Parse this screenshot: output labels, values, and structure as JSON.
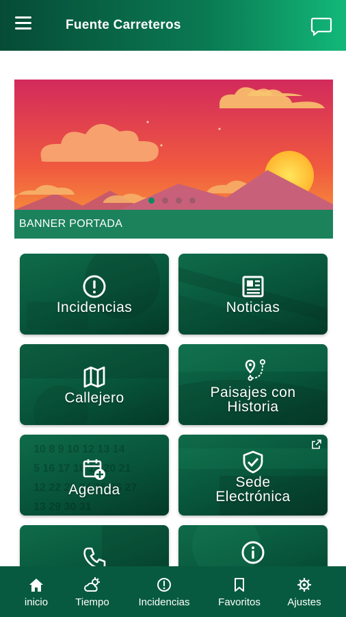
{
  "header": {
    "title": "Fuente Carreteros",
    "menu_icon": "hamburger-menu-icon",
    "chat_icon": "chat-bubble-icon"
  },
  "banner": {
    "caption": "BANNER PORTADA",
    "slides_count": 4,
    "active_slide": 1
  },
  "tiles": [
    {
      "label_line1": "Incidencias",
      "label_line2": "",
      "icon": "alert-circle-icon"
    },
    {
      "label_line1": "Noticias",
      "label_line2": "",
      "icon": "newspaper-icon"
    },
    {
      "label_line1": "Callejero",
      "label_line2": "",
      "icon": "map-icon"
    },
    {
      "label_line1": "Paisajes con",
      "label_line2": "Historia",
      "icon": "route-pin-icon"
    },
    {
      "label_line1": "Agenda",
      "label_line2": "",
      "icon": "calendar-add-icon"
    },
    {
      "label_line1": "Sede",
      "label_line2": "Electrónica",
      "icon": "shield-check-icon",
      "external": true
    },
    {
      "label_line1": "",
      "label_line2": "",
      "icon": "phone-icon"
    },
    {
      "label_line1": "",
      "label_line2": "",
      "icon": "info-circle-icon"
    }
  ],
  "tabbar": {
    "items": [
      {
        "label": "inicio",
        "icon": "home-icon"
      },
      {
        "label": "Tiempo",
        "icon": "weather-icon"
      },
      {
        "label": "Incidencias",
        "icon": "alert-circle-icon"
      },
      {
        "label": "Favoritos",
        "icon": "bookmark-icon"
      },
      {
        "label": "Ajustes",
        "icon": "gear-icon"
      }
    ]
  },
  "colors": {
    "primary": "#075a3f",
    "accent": "#12b879"
  }
}
